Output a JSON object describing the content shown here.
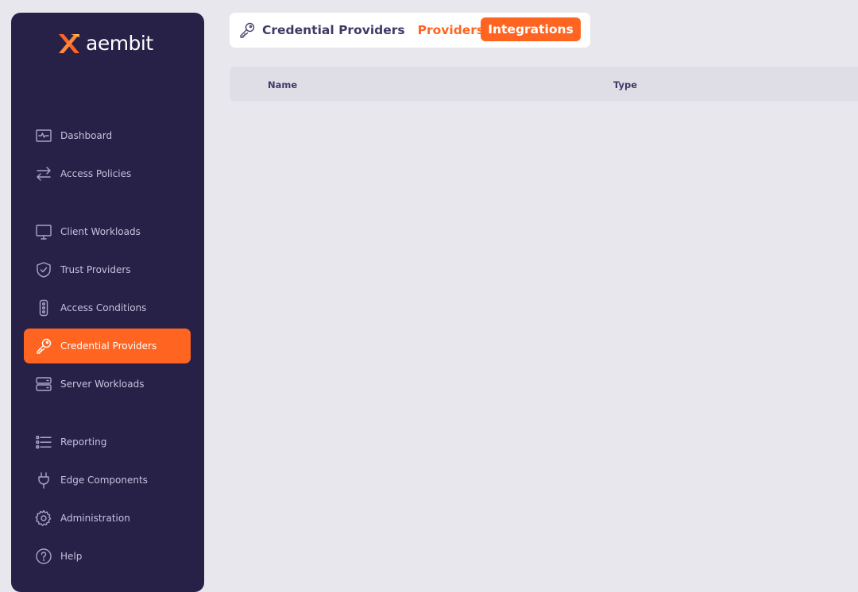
{
  "brand": {
    "name": "aembit",
    "accent_color": "#ff6421",
    "sidebar_color": "#272148"
  },
  "sidebar": {
    "items": [
      {
        "label": "Dashboard",
        "icon": "dashboard-icon"
      },
      {
        "label": "Access Policies",
        "icon": "arrows-swap-icon"
      },
      {
        "label": "Client Workloads",
        "icon": "monitor-icon"
      },
      {
        "label": "Trust Providers",
        "icon": "shield-check-icon"
      },
      {
        "label": "Access Conditions",
        "icon": "traffic-light-icon"
      },
      {
        "label": "Credential Providers",
        "icon": "key-icon",
        "active": true
      },
      {
        "label": "Server Workloads",
        "icon": "server-icon"
      },
      {
        "label": "Reporting",
        "icon": "list-icon"
      },
      {
        "label": "Edge Components",
        "icon": "plug-icon"
      },
      {
        "label": "Administration",
        "icon": "gear-icon"
      },
      {
        "label": "Help",
        "icon": "help-icon"
      }
    ]
  },
  "header": {
    "title": "Credential Providers",
    "tabs": [
      {
        "label": "Providers"
      },
      {
        "label": "Integrations",
        "selected": true
      }
    ]
  },
  "table": {
    "columns": [
      "Name",
      "Type"
    ],
    "rows": []
  }
}
